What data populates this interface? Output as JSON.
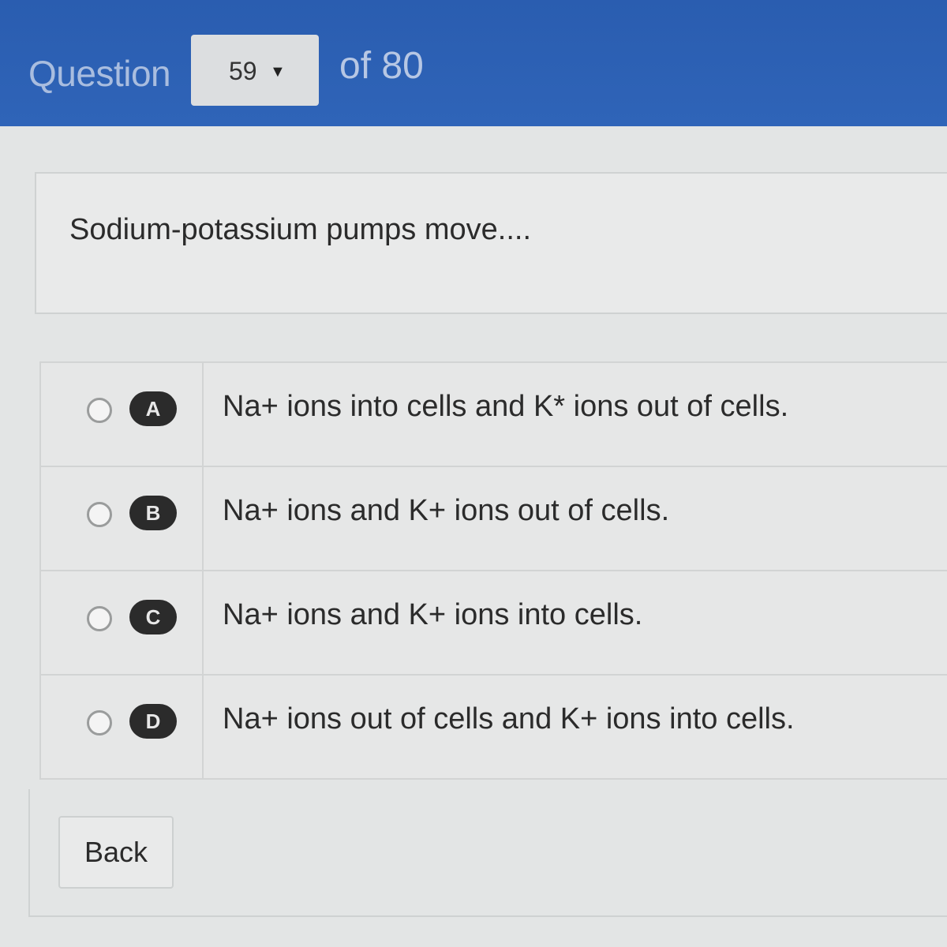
{
  "header": {
    "label": "Question",
    "selected_question": "59",
    "caret": "▼",
    "total": "of 80"
  },
  "question": {
    "prompt": "Sodium-potassium pumps move...."
  },
  "options": [
    {
      "letter": "A",
      "text": "Na+ ions into cells and K* ions out of cells."
    },
    {
      "letter": "B",
      "text": "Na+ ions and K+ ions out of cells."
    },
    {
      "letter": "C",
      "text": "Na+ ions and K+ ions into cells."
    },
    {
      "letter": "D",
      "text": "Na+ ions out of cells and K+ ions into cells."
    }
  ],
  "footer": {
    "back_label": "Back"
  }
}
